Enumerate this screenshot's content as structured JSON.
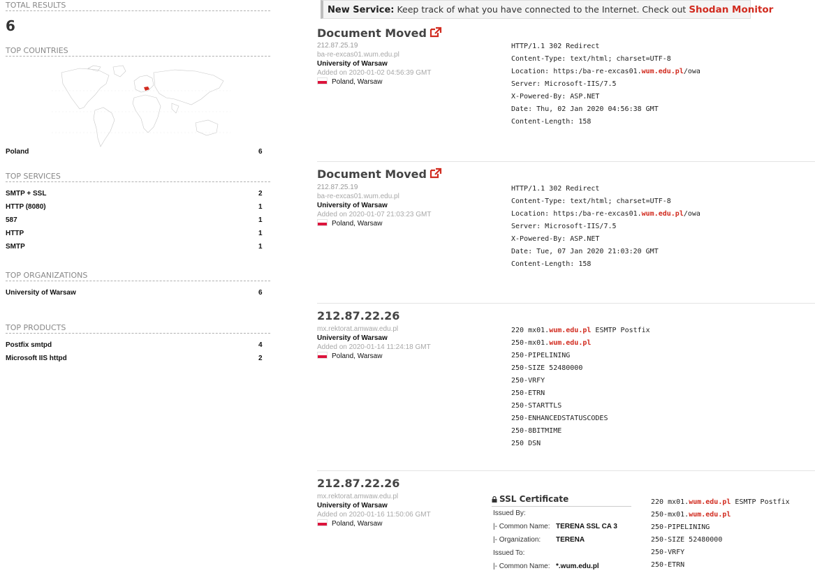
{
  "sidebar": {
    "total_results": {
      "title": "TOTAL RESULTS",
      "value": "6"
    },
    "top_countries": {
      "title": "TOP COUNTRIES",
      "items": [
        {
          "label": "Poland",
          "count": "6"
        }
      ]
    },
    "top_services": {
      "title": "TOP SERVICES",
      "items": [
        {
          "label": "SMTP + SSL",
          "count": "2"
        },
        {
          "label": "HTTP (8080)",
          "count": "1"
        },
        {
          "label": "587",
          "count": "1"
        },
        {
          "label": "HTTP",
          "count": "1"
        },
        {
          "label": "SMTP",
          "count": "1"
        }
      ]
    },
    "top_organizations": {
      "title": "TOP ORGANIZATIONS",
      "items": [
        {
          "label": "University of Warsaw",
          "count": "6"
        }
      ]
    },
    "top_products": {
      "title": "TOP PRODUCTS",
      "items": [
        {
          "label": "Postfix smtpd",
          "count": "4"
        },
        {
          "label": "Microsoft IIS httpd",
          "count": "2"
        }
      ]
    }
  },
  "promo": {
    "label": "New Service:",
    "text": "Keep track of what you have connected to the Internet. Check out",
    "link": "Shodan Monitor"
  },
  "results": [
    {
      "title": "Document Moved",
      "ip": "212.87.25.19",
      "hostname": "ba-re-excas01.wum.edu.pl",
      "org": "University of Warsaw",
      "added": "Added on 2020-01-02 04:56:39 GMT",
      "country": "Poland",
      "city": "Warsaw",
      "banner": [
        [
          "HTTP/1.1 302 Redirect"
        ],
        [
          "Content-Type: text/html; charset=UTF-8"
        ],
        [
          "Location: https:/ba-re-excas01.",
          "wum.edu.pl",
          "/owa"
        ],
        [
          "Server: Microsoft-IIS/7.5"
        ],
        [
          "X-Powered-By: ASP.NET"
        ],
        [
          "Date: Thu, 02 Jan 2020 04:56:38 GMT"
        ],
        [
          "Content-Length: 158"
        ]
      ]
    },
    {
      "title": "Document Moved",
      "ip": "212.87.25.19",
      "hostname": "ba-re-excas01.wum.edu.pl",
      "org": "University of Warsaw",
      "added": "Added on 2020-01-07 21:03:23 GMT",
      "country": "Poland",
      "city": "Warsaw",
      "banner": [
        [
          "HTTP/1.1 302 Redirect"
        ],
        [
          "Content-Type: text/html; charset=UTF-8"
        ],
        [
          "Location: https:/ba-re-excas01.",
          "wum.edu.pl",
          "/owa"
        ],
        [
          "Server: Microsoft-IIS/7.5"
        ],
        [
          "X-Powered-By: ASP.NET"
        ],
        [
          "Date: Tue, 07 Jan 2020 21:03:20 GMT"
        ],
        [
          "Content-Length: 158"
        ]
      ]
    },
    {
      "title": "212.87.22.26",
      "ip": "",
      "hostname": "mx.rektorat.amwaw.edu.pl",
      "org": "University of Warsaw",
      "added": "Added on 2020-01-14 11:24:18 GMT",
      "country": "Poland",
      "city": "Warsaw",
      "banner": [
        [
          "220 mx01.",
          "wum.edu.pl",
          " ESMTP Postfix"
        ],
        [
          "250-mx01.",
          "wum.edu.pl",
          ""
        ],
        [
          "250-PIPELINING"
        ],
        [
          "250-SIZE 52480000"
        ],
        [
          "250-VRFY"
        ],
        [
          "250-ETRN"
        ],
        [
          "250-STARTTLS"
        ],
        [
          "250-ENHANCEDSTATUSCODES"
        ],
        [
          "250-8BITMIME"
        ],
        [
          "250 DSN"
        ]
      ]
    },
    {
      "title": "212.87.22.26",
      "ip": "",
      "hostname": "mx.rektorat.amwaw.edu.pl",
      "org": "University of Warsaw",
      "added": "Added on 2020-01-16 11:50:06 GMT",
      "country": "Poland",
      "city": "Warsaw",
      "ssl": {
        "title": "SSL Certificate",
        "issued_by": "Issued By:",
        "issuer_cn_label": "|- Common Name:",
        "issuer_cn": "TERENA SSL CA 3",
        "issuer_org_label": "|- Organization:",
        "issuer_org": "TERENA",
        "issued_to": "Issued To:",
        "subject_cn_label": "|- Common Name:",
        "subject_cn": "*.wum.edu.pl"
      },
      "banner": [
        [
          "220 mx01.",
          "wum.edu.pl",
          " ESMTP Postfix"
        ],
        [
          "250-mx01.",
          "wum.edu.pl",
          ""
        ],
        [
          "250-PIPELINING"
        ],
        [
          "250-SIZE 52480000"
        ],
        [
          "250-VRFY"
        ],
        [
          "250-ETRN"
        ]
      ]
    }
  ],
  "colors": {
    "accent": "#d12b1f",
    "flag_red": "#dc143c"
  }
}
